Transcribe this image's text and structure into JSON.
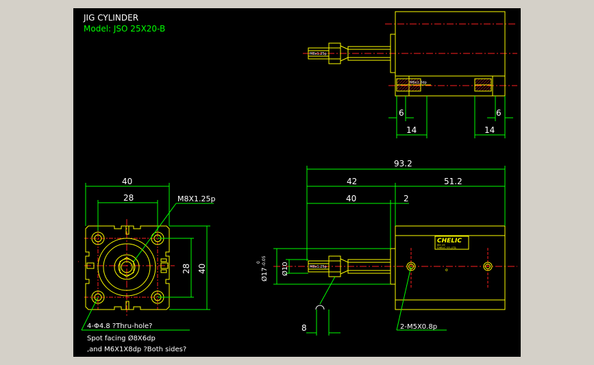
{
  "title": {
    "line1": "JIG CYLINDER",
    "line2": "Model: JSO 25X20-B"
  },
  "colors": {
    "background": "#000000",
    "frame": "#d4d0c8",
    "outline": "#ffff00",
    "dimension": "#00ff00",
    "centerline": "#ff2020",
    "text": "#ffffff",
    "hatch": "#ff2020",
    "text_accent": "#00ff00"
  },
  "top_view": {
    "dims": [
      "6",
      "14",
      "6",
      "14"
    ],
    "rod_thread_label": "M8x1.25p",
    "port_label": "M6x1.0dp"
  },
  "front_view": {
    "dims": [
      "40",
      "28",
      "28",
      "40"
    ],
    "thread_callout": "M8X1.25p",
    "note_lines": [
      "4-Φ4.8 ?Thru-hole?",
      "Spot facing Ø8X6dp",
      ",and M6X1X8dp ?Both sides?"
    ]
  },
  "side_view": {
    "dims": [
      "93.2",
      "42",
      "51.2",
      "40",
      "2",
      "8"
    ],
    "rod_diameter_label": "Ø10",
    "flange_dia_label": "Ø17",
    "flange_tol_upper": "0",
    "flange_tol_lower": "-0.05",
    "rod_thread_label": "M8x1.25p",
    "port_callout": "2-M5X0.8p",
    "nameplate_brand": "CHELIC",
    "nameplate_small_1": "JSO 25",
    "nameplate_small_2": "CHELIC CO.,LTD.",
    "center_mark": "o"
  }
}
